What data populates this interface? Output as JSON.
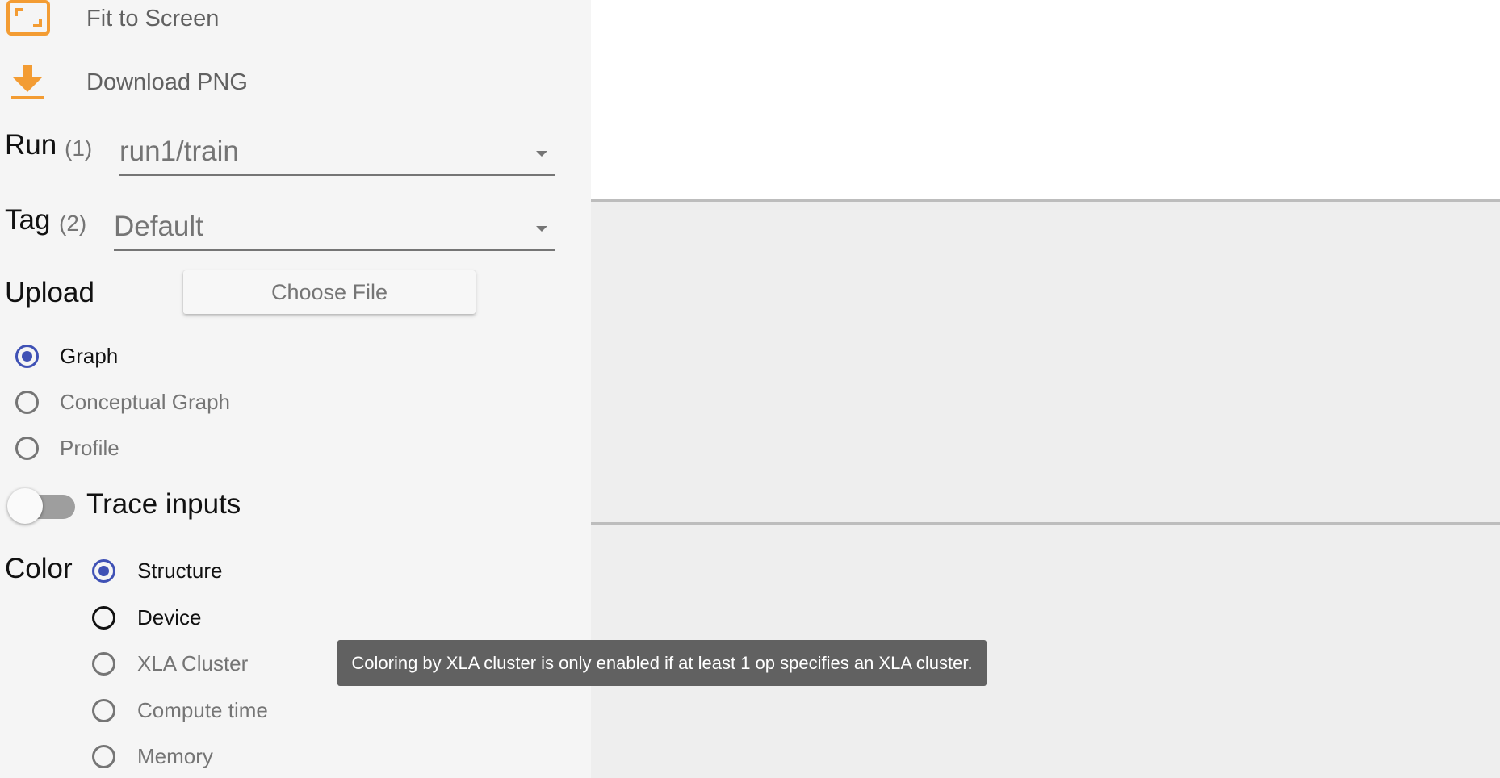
{
  "actions": {
    "fit_to_screen": "Fit to Screen",
    "download_png": "Download PNG"
  },
  "run": {
    "label": "Run",
    "count": "(1)",
    "value": "run1/train"
  },
  "tag": {
    "label": "Tag",
    "count": "(2)",
    "value": "Default"
  },
  "upload": {
    "label": "Upload",
    "button": "Choose File"
  },
  "graph_type": {
    "options": [
      "Graph",
      "Conceptual Graph",
      "Profile"
    ],
    "selected": "Graph"
  },
  "trace_inputs": {
    "label": "Trace inputs",
    "enabled": false
  },
  "color": {
    "label": "Color",
    "options": [
      "Structure",
      "Device",
      "XLA Cluster",
      "Compute time",
      "Memory"
    ],
    "selected": "Structure"
  },
  "tooltip": "Coloring by XLA cluster is only enabled if at least 1 op specifies an XLA cluster.",
  "colors": {
    "accent": "#f39c33",
    "radio_selected": "#3f51b5"
  },
  "icons": {
    "fit": "fit-to-screen-icon",
    "download": "download-icon",
    "select_arrow": "dropdown-arrow-icon"
  }
}
